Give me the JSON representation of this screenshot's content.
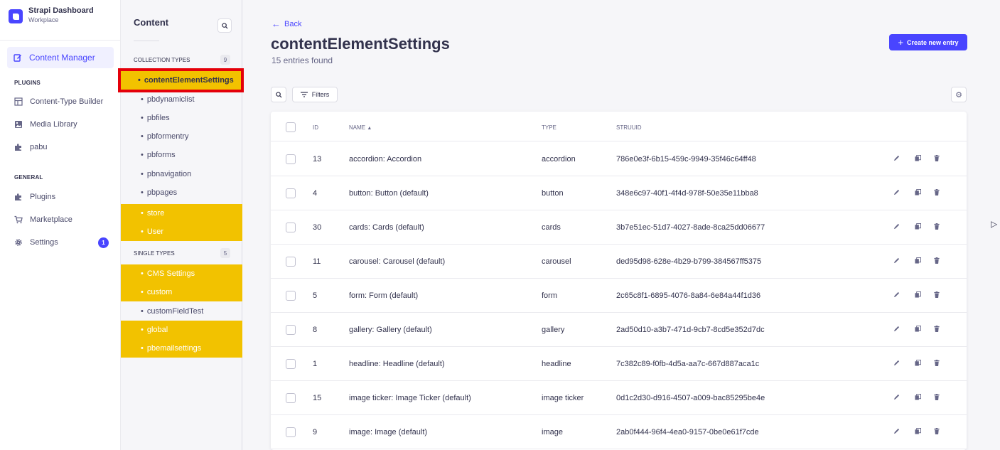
{
  "brand": {
    "title": "Strapi Dashboard",
    "subtitle": "Workplace"
  },
  "mainnav": {
    "active_label": "Content Manager",
    "plugins_header": "PLUGINS",
    "plugins": [
      "Content-Type Builder",
      "Media Library",
      "pabu"
    ],
    "general_header": "GENERAL",
    "general": [
      "Plugins",
      "Marketplace",
      "Settings"
    ],
    "settings_badge": "1"
  },
  "subnav": {
    "title": "Content",
    "collection_header": "COLLECTION TYPES",
    "collection_count": "9",
    "collection_types": [
      "contentElementSettings",
      "pbdynamiclist",
      "pbfiles",
      "pbformentry",
      "pbforms",
      "pbnavigation",
      "pbpages",
      "store",
      "User"
    ],
    "single_header": "SINGLE TYPES",
    "single_count": "5",
    "single_types": [
      "CMS Settings",
      "custom",
      "customFieldTest",
      "global",
      "pbemailsettings"
    ]
  },
  "main": {
    "back_label": "Back",
    "title": "contentElementSettings",
    "subtitle": "15 entries found",
    "create_label": "Create new entry",
    "filters_label": "Filters"
  },
  "table": {
    "headers": {
      "id": "ID",
      "name": "NAME",
      "type": "TYPE",
      "uuid": "STRUUID"
    },
    "rows": [
      {
        "id": "13",
        "name": "accordion: Accordion",
        "type": "accordion",
        "uuid": "786e0e3f-6b15-459c-9949-35f46c64ff48"
      },
      {
        "id": "4",
        "name": "button: Button (default)",
        "type": "button",
        "uuid": "348e6c97-40f1-4f4d-978f-50e35e11bba8"
      },
      {
        "id": "30",
        "name": "cards: Cards (default)",
        "type": "cards",
        "uuid": "3b7e51ec-51d7-4027-8ade-8ca25dd06677"
      },
      {
        "id": "11",
        "name": "carousel: Carousel (default)",
        "type": "carousel",
        "uuid": "ded95d98-628e-4b29-b799-384567ff5375"
      },
      {
        "id": "5",
        "name": "form: Form (default)",
        "type": "form",
        "uuid": "2c65c8f1-6895-4076-8a84-6e84a44f1d36"
      },
      {
        "id": "8",
        "name": "gallery: Gallery (default)",
        "type": "gallery",
        "uuid": "2ad50d10-a3b7-471d-9cb7-8cd5e352d7dc"
      },
      {
        "id": "1",
        "name": "headline: Headline (default)",
        "type": "headline",
        "uuid": "7c382c89-f0fb-4d5a-aa7c-667d887aca1c"
      },
      {
        "id": "15",
        "name": "image ticker: Image Ticker (default)",
        "type": "image ticker",
        "uuid": "0d1c2d30-d916-4507-a009-bac85295be4e"
      },
      {
        "id": "9",
        "name": "image: Image (default)",
        "type": "image",
        "uuid": "2ab0f444-96f4-4ea0-9157-0be0e61f7cde"
      }
    ]
  },
  "colors": {
    "accent": "#4945ff",
    "highlight": "#f2c200",
    "selection_border": "#e4000a"
  }
}
